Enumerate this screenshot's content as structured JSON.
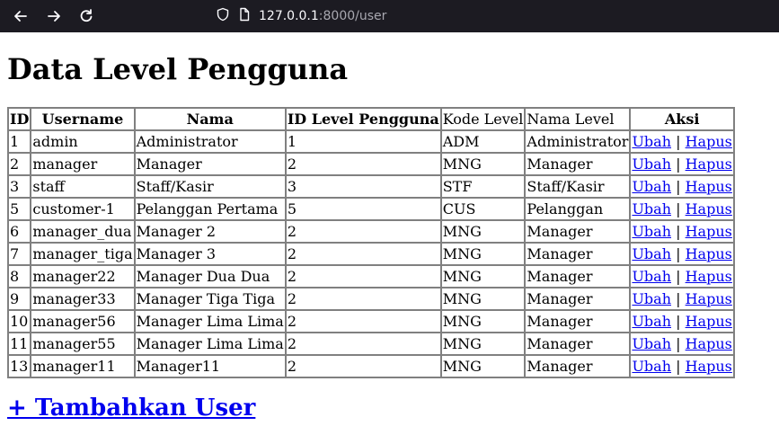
{
  "browser": {
    "url_host": "127.0.0.1",
    "url_rest": ":8000/user"
  },
  "page": {
    "title": "Data Level Pengguna",
    "add_link": "+ Tambahkan User"
  },
  "table": {
    "headers": [
      "ID",
      "Username",
      "Nama",
      "ID Level Pengguna",
      "Kode Level",
      "Nama Level",
      "Aksi"
    ],
    "rows": [
      [
        "1",
        "admin",
        "Administrator",
        "1",
        "ADM",
        "Administrator"
      ],
      [
        "2",
        "manager",
        "Manager",
        "2",
        "MNG",
        "Manager"
      ],
      [
        "3",
        "staff",
        "Staff/Kasir",
        "3",
        "STF",
        "Staff/Kasir"
      ],
      [
        "5",
        "customer-1",
        "Pelanggan Pertama",
        "5",
        "CUS",
        "Pelanggan"
      ],
      [
        "6",
        "manager_dua",
        "Manager 2",
        "2",
        "MNG",
        "Manager"
      ],
      [
        "7",
        "manager_tiga",
        "Manager 3",
        "2",
        "MNG",
        "Manager"
      ],
      [
        "8",
        "manager22",
        "Manager Dua Dua",
        "2",
        "MNG",
        "Manager"
      ],
      [
        "9",
        "manager33",
        "Manager Tiga Tiga",
        "2",
        "MNG",
        "Manager"
      ],
      [
        "10",
        "manager56",
        "Manager Lima Lima",
        "2",
        "MNG",
        "Manager"
      ],
      [
        "11",
        "manager55",
        "Manager Lima Lima",
        "2",
        "MNG",
        "Manager"
      ],
      [
        "13",
        "manager11",
        "Manager11",
        "2",
        "MNG",
        "Manager"
      ]
    ],
    "action_edit": "Ubah",
    "action_separator": "|",
    "action_delete": "Hapus"
  }
}
